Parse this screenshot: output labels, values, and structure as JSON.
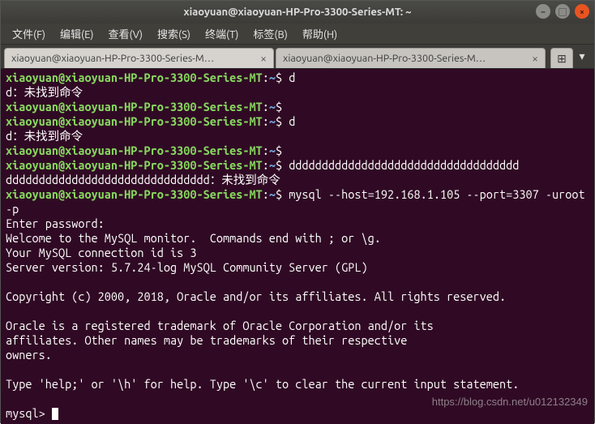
{
  "window": {
    "title": "xiaoyuan@xiaoyuan-HP-Pro-3300-Series-MT: ~"
  },
  "menu": {
    "file": "文件(F)",
    "edit": "编辑(E)",
    "view": "查看(V)",
    "search": "搜索(S)",
    "term": "终端(T)",
    "tabs": "标签(B)",
    "help": "帮助(H)"
  },
  "tabs": {
    "t0": "xiaoyuan@xiaoyuan-HP-Pro-3300-Series-M…",
    "t1": "xiaoyuan@xiaoyuan-HP-Pro-3300-Series-M…",
    "close_glyph": "×",
    "add_glyph": "⊞",
    "menu_glyph": "▾"
  },
  "prompt": {
    "user_host": "xiaoyuan@xiaoyuan-HP-Pro-3300-Series-MT",
    "colon": ":",
    "path": "~",
    "dollar": "$ "
  },
  "lines": {
    "cmd1": "d",
    "err1": "d：未找到命令",
    "cmd2": "",
    "cmd3": "d",
    "err3": "d：未找到命令",
    "cmd4": "",
    "cmd5": "ddddddddddddddddddddddddddddddddddd",
    "err5": "ddddddddddddddddddddddddddddddd：未找到命令",
    "cmd6": "mysql --host=192.168.1.105 --port=3307 -uroot -p",
    "out_enter": "Enter password:",
    "out_welcome": "Welcome to the MySQL monitor.  Commands end with ; or \\g.",
    "out_conn": "Your MySQL connection id is 3",
    "out_ver": "Server version: 5.7.24-log MySQL Community Server (GPL)",
    "out_blank1": "",
    "out_copy": "Copyright (c) 2000, 2018, Oracle and/or its affiliates. All rights reserved.",
    "out_blank2": "",
    "out_tm1": "Oracle is a registered trademark of Oracle Corporation and/or its",
    "out_tm2": "affiliates. Other names may be trademarks of their respective",
    "out_tm3": "owners.",
    "out_blank3": "",
    "out_help": "Type 'help;' or '\\h' for help. Type '\\c' to clear the current input statement.",
    "out_blank4": "",
    "mysql_prompt": "mysql> "
  },
  "watermark": "https://blog.csdn.net/u012132349"
}
